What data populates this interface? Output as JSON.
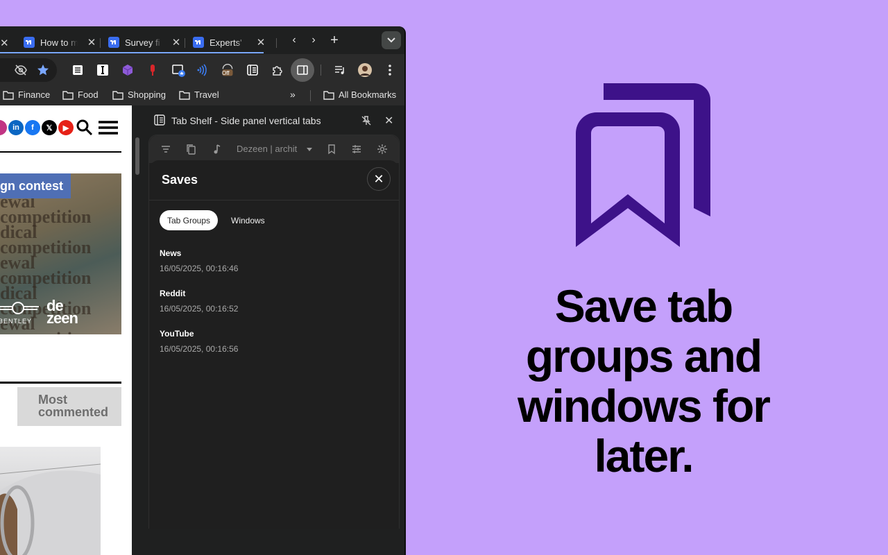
{
  "tabs": [
    {
      "title": "How to m"
    },
    {
      "title": "Survey fi"
    },
    {
      "title": "Experts'"
    }
  ],
  "bookmarks": [
    {
      "label": "Finance"
    },
    {
      "label": "Food"
    },
    {
      "label": "Shopping"
    },
    {
      "label": "Travel"
    }
  ],
  "all_bookmarks_label": "All Bookmarks",
  "toolbar": {
    "off_badge": "Off"
  },
  "page": {
    "badge_text": "gn contest",
    "hero_words": [
      "ewal competition",
      "dical competition",
      "ewal competition",
      "dical competition",
      "ewal competition"
    ],
    "dezeen_top": "de",
    "dezeen_bottom": "zeen",
    "bentley": "BENTLEY",
    "most_commented_1": "Most",
    "most_commented_2": "commented"
  },
  "side_panel": {
    "title": "Tab Shelf - Side panel vertical tabs",
    "window_select": "Dezeen | archit",
    "saves_title": "Saves",
    "tabs": [
      "Tab Groups",
      "Windows"
    ],
    "items": [
      {
        "name": "News",
        "date": "16/05/2025, 00:16:46"
      },
      {
        "name": "Reddit",
        "date": "16/05/2025, 00:16:52"
      },
      {
        "name": "YouTube",
        "date": "16/05/2025, 00:16:56"
      }
    ]
  },
  "headline": {
    "line1": "Save tab",
    "line2": "groups and",
    "line3": "windows for",
    "line4": "later."
  },
  "colors": {
    "background": "#c4a0fb",
    "logo": "#3d1289",
    "panel": "#1f1f1f"
  }
}
